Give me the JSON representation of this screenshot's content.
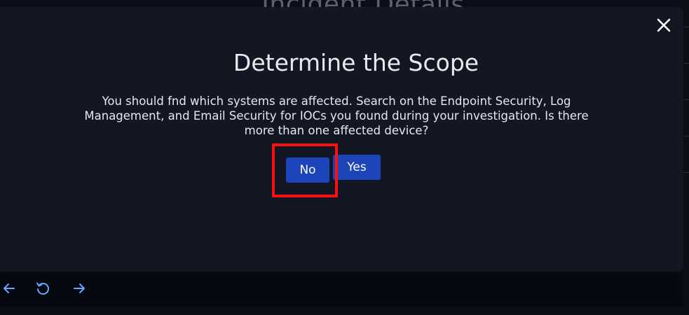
{
  "background": {
    "title": "Incident Details"
  },
  "modal": {
    "title": "Determine the Scope",
    "body_line1": "You should fnd which systems are affected. Search on the Endpoint Security, Log",
    "body_line2": "Management, and Email Security for IOCs you found during your investigation. Is there",
    "body_line3": "more than one affected device?",
    "close_icon": "close-icon",
    "buttons": {
      "no_label": "No",
      "yes_label": "Yes"
    }
  },
  "footer": {
    "icons": [
      "arrow-left-icon",
      "restart-icon",
      "arrow-right-icon"
    ]
  },
  "colors": {
    "modal_bg": "#121723",
    "button": "#1b45b8",
    "highlight": "#ff1010",
    "footer_icon": "#6aa6ff"
  }
}
